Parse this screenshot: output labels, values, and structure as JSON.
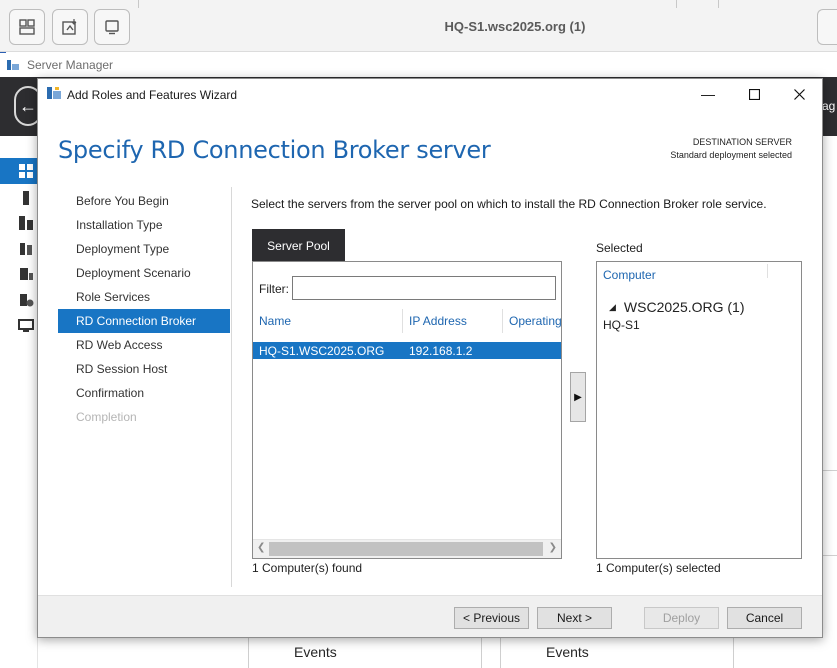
{
  "viewer": {
    "title": "HQ-S1.wsc2025.org (1)",
    "buttons": [
      "window-layout-icon",
      "screenshot-icon",
      "display-icon"
    ]
  },
  "server_manager": {
    "title": "Server Manager",
    "header_right": "ag",
    "events": [
      "Events",
      "Events"
    ]
  },
  "wizard": {
    "title": "Add Roles and Features Wizard",
    "heading": "Specify RD Connection Broker server",
    "destination": {
      "label": "DESTINATION SERVER",
      "value": "Standard deployment selected"
    },
    "steps": [
      {
        "label": "Before You Begin",
        "state": "normal"
      },
      {
        "label": "Installation Type",
        "state": "normal"
      },
      {
        "label": "Deployment Type",
        "state": "normal"
      },
      {
        "label": "Deployment Scenario",
        "state": "normal"
      },
      {
        "label": "Role Services",
        "state": "normal"
      },
      {
        "label": "RD Connection Broker",
        "state": "selected"
      },
      {
        "label": "RD Web Access",
        "state": "normal"
      },
      {
        "label": "RD Session Host",
        "state": "normal"
      },
      {
        "label": "Confirmation",
        "state": "normal"
      },
      {
        "label": "Completion",
        "state": "disabled"
      }
    ],
    "instruction": "Select the servers from the server pool on which to install the RD Connection Broker role service.",
    "server_pool": {
      "tab_label": "Server Pool",
      "filter_label": "Filter:",
      "filter_value": "",
      "columns": [
        "Name",
        "IP Address",
        "Operating"
      ],
      "rows": [
        {
          "name": "HQ-S1.WSC2025.ORG",
          "ip": "192.168.1.2",
          "os": ""
        }
      ],
      "count_text": "1 Computer(s) found"
    },
    "add_arrow": "▶",
    "selected": {
      "label": "Selected",
      "column": "Computer",
      "group": "WSC2025.ORG (1)",
      "items": [
        "HQ-S1"
      ],
      "count_text": "1 Computer(s) selected"
    },
    "buttons": {
      "previous": "< Previous",
      "next": "Next >",
      "deploy": "Deploy",
      "cancel": "Cancel"
    }
  },
  "colors": {
    "accent": "#1875c4",
    "heading": "#1e66b0",
    "header_dark": "#2d2d30"
  }
}
